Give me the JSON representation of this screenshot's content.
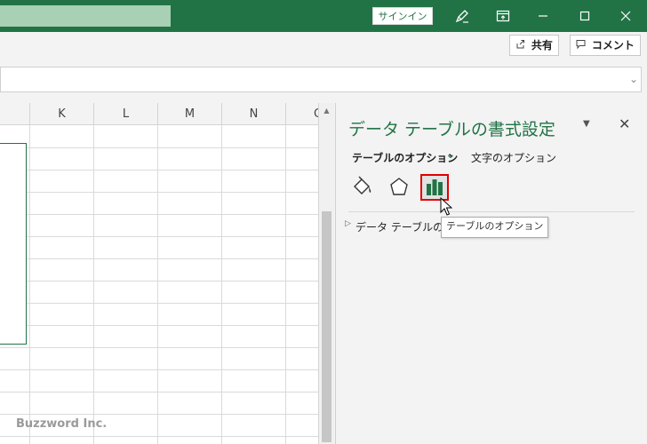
{
  "titlebar": {
    "signin_label": "サインイン",
    "colors": {
      "bar": "#217346"
    }
  },
  "ribbon": {
    "share_label": "共有",
    "comment_label": "コメント",
    "share_icon": "share-icon",
    "comment_icon": "comment-icon"
  },
  "sheet": {
    "columns": [
      "K",
      "L",
      "M",
      "N",
      "O"
    ]
  },
  "panel": {
    "title": "データ テーブルの書式設定",
    "tab_options": "テーブルのオプション",
    "tab_text": "文字のオプション",
    "section_label": "データ テーブルの",
    "tooltip": "テーブルのオプション"
  },
  "watermark": "Buzzword Inc."
}
